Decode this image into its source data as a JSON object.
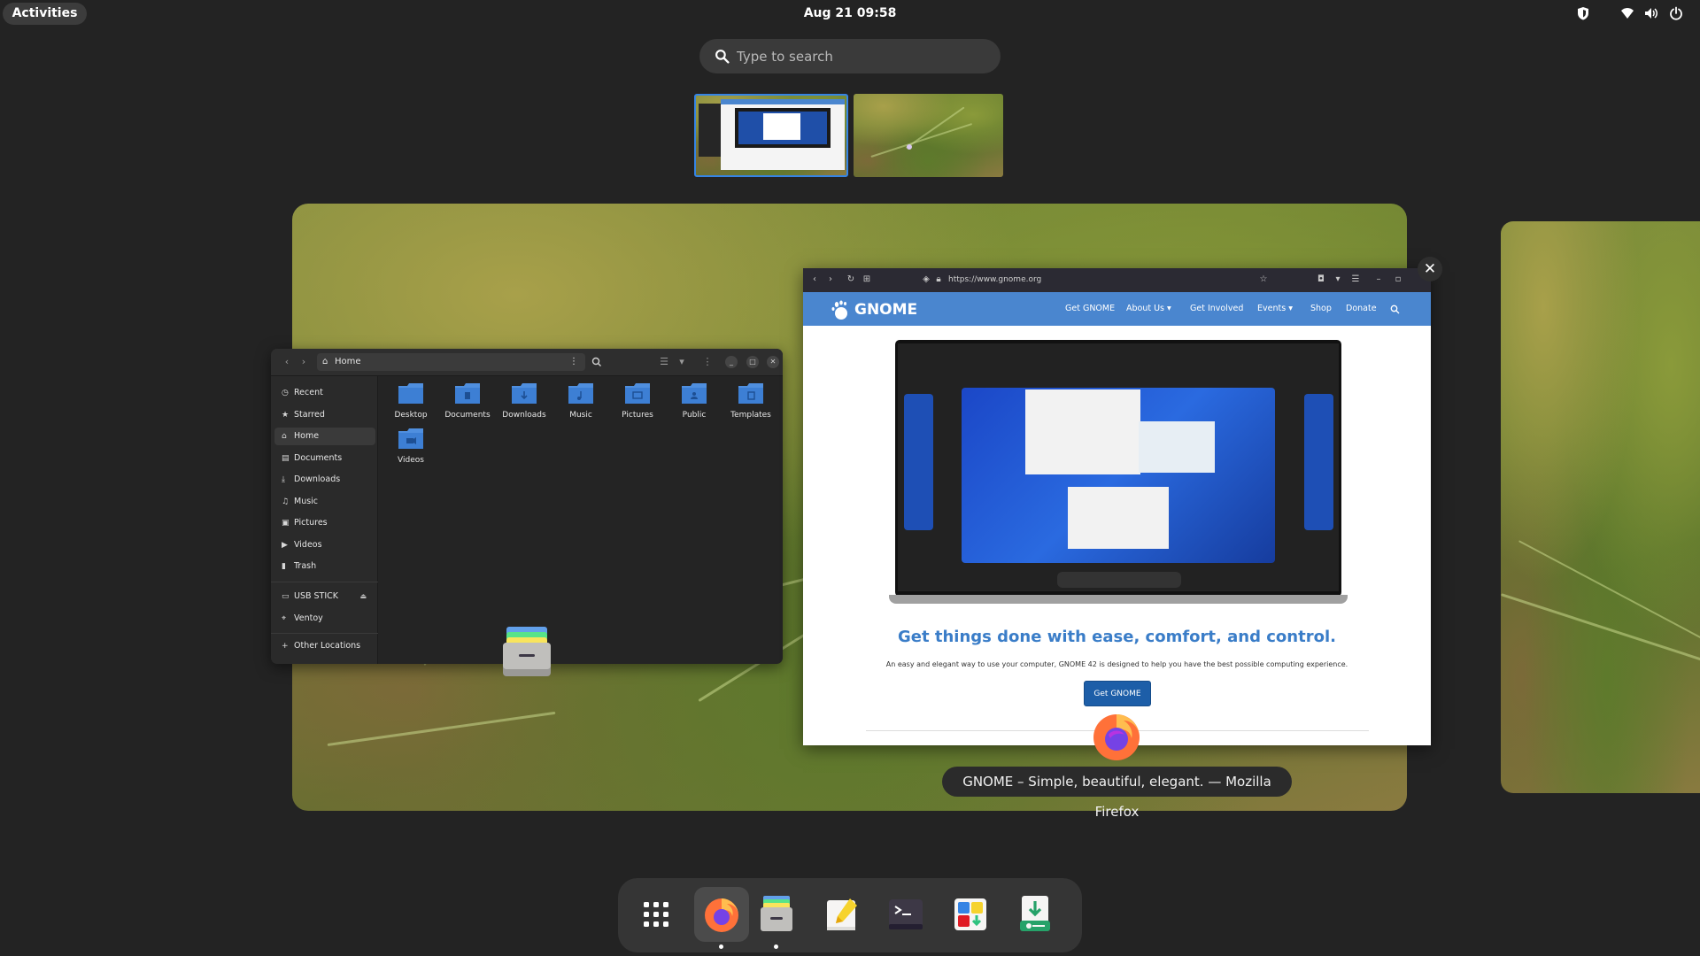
{
  "topbar": {
    "activities_label": "Activities",
    "clock": "Aug 21  09:58",
    "tray_icons": [
      "shield-icon",
      "wifi-icon",
      "volume-icon",
      "power-icon"
    ]
  },
  "search": {
    "placeholder": "Type to search"
  },
  "workspaces": {
    "count": 2,
    "active_index": 0
  },
  "files_window": {
    "path_label": "Home",
    "sidebar": {
      "places": [
        "Recent",
        "Starred",
        "Home",
        "Documents",
        "Downloads",
        "Music",
        "Pictures",
        "Videos",
        "Trash"
      ],
      "devices": [
        "USB STICK",
        "Ventoy"
      ],
      "other": "Other Locations",
      "active": "Home"
    },
    "folders": [
      "Desktop",
      "Documents",
      "Downloads",
      "Music",
      "Pictures",
      "Public",
      "Templates",
      "Videos"
    ]
  },
  "firefox_window": {
    "url": "https://www.gnome.org",
    "nav": {
      "logo": "GNOME",
      "links": [
        "Get GNOME",
        "About Us",
        "Get Involved",
        "Events",
        "Shop",
        "Donate"
      ]
    },
    "headline": "Get things done with ease, comfort, and control.",
    "subtext": "An easy and elegant way to use your computer, GNOME 42 is designed to help you have the best possible computing experience.",
    "cta": "Get GNOME"
  },
  "window_caption": "GNOME – Simple, beautiful, elegant. — Mozilla Firefox",
  "dash": {
    "items": [
      "app-grid-icon",
      "firefox-icon",
      "files-icon",
      "text-editor-icon",
      "terminal-icon",
      "software-icon",
      "flatseal-icon"
    ],
    "running": [
      "firefox-icon",
      "files-icon"
    ],
    "focused": "firefox-icon"
  },
  "colors": {
    "accent": "#3584e4",
    "gnome_blue": "#4a86cf",
    "headline_blue": "#3a7dc8"
  }
}
